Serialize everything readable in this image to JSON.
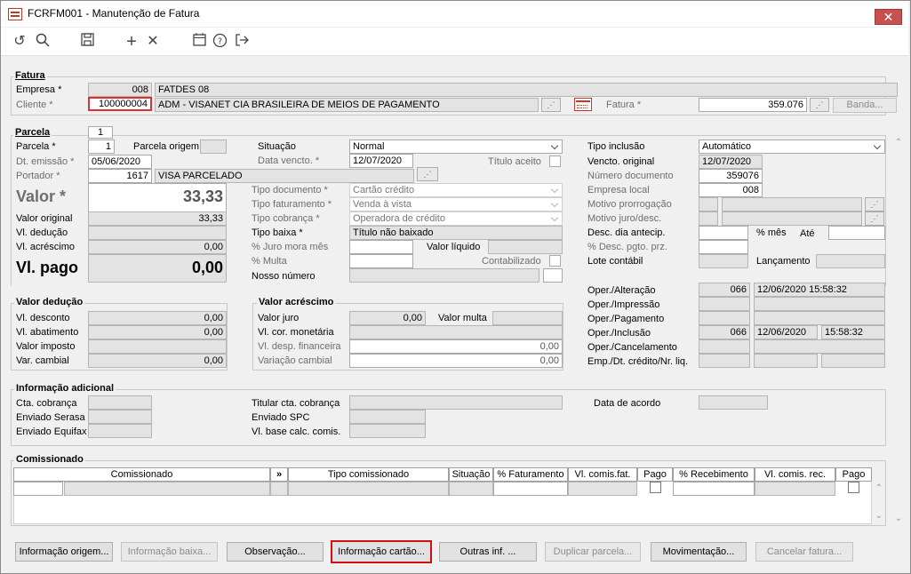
{
  "window": {
    "title": "FCRFM001 - Manutenção de Fatura",
    "close": "✕"
  },
  "toolbar": {
    "undo": "↺",
    "search": "🔍",
    "save": "💾",
    "add": "+",
    "delete": "✕",
    "calendar": "📅",
    "help": "?",
    "exit": "↦"
  },
  "fatura": {
    "section": "Fatura",
    "empresa_label": "Empresa *",
    "empresa_code": "008",
    "empresa_name": "FATDES 08",
    "cliente_label": "Cliente *",
    "cliente_code": "100000004",
    "cliente_name": "ADM - VISANET CIA BRASILEIRA DE MEIOS DE PAGAMENTO",
    "fatura_label": "Fatura *",
    "fatura_value": "359.076",
    "banda": "Banda..."
  },
  "parcela": {
    "section": "Parcela",
    "tab": "1",
    "parcela_label": "Parcela *",
    "parcela_value": "1",
    "parcela_origem": "Parcela origem",
    "dt_emissao_label": "Dt. emissão *",
    "dt_emissao": "05/06/2020",
    "portador_label": "Portador *",
    "portador_code": "1617",
    "portador_name": "VISA PARCELADO",
    "valor_label": "Valor *",
    "valor": "33,33",
    "valor_original_label": "Valor original",
    "valor_original": "33,33",
    "vl_deducao_label": "Vl. dedução",
    "vl_acrescimo_label": "Vl. acréscimo",
    "vl_acrescimo": "0,00",
    "vl_pago_label": "Vl. pago",
    "vl_pago": "0,00"
  },
  "mid": {
    "situacao_label": "Situação",
    "situacao": "Normal",
    "data_vencto_label": "Data vencto. *",
    "data_vencto": "12/07/2020",
    "titulo_aceito": "Título aceito",
    "tipo_documento_label": "Tipo documento *",
    "tipo_documento": "Cartão crédito",
    "tipo_faturamento_label": "Tipo faturamento *",
    "tipo_faturamento": "Venda à vista",
    "tipo_cobranca_label": "Tipo cobrança *",
    "tipo_cobranca": "Operadora de crédito",
    "tipo_baixa_label": "Tipo baixa *",
    "tipo_baixa": "Título não baixado",
    "juro_mora_label": "% Juro mora mês",
    "valor_liquido": "Valor líquido",
    "multa_label": "% Multa",
    "contabilizado": "Contabilizado",
    "nosso_numero_label": "Nosso número"
  },
  "right": {
    "tipo_inclusao_label": "Tipo inclusão",
    "tipo_inclusao": "Automático",
    "vencto_original_label": "Vencto. original",
    "vencto_original": "12/07/2020",
    "numero_documento_label": "Número documento",
    "numero_documento": "359076",
    "empresa_local_label": "Empresa local",
    "empresa_local": "008",
    "motivo_prorrogacao_label": "Motivo prorrogação",
    "motivo_juro_label": "Motivo juro/desc.",
    "desc_dia_antecip_label": "Desc. dia antecip.",
    "pct_mes": "% mês",
    "ate": "Até",
    "pct_desc_pgto_label": "% Desc. pgto. prz.",
    "lote_contabil_label": "Lote contábil",
    "lancamento": "Lançamento"
  },
  "oper": {
    "alteracao_label": "Oper./Alteração",
    "alteracao_code": "066",
    "alteracao_dt": "12/06/2020 15:58:32",
    "impressao_label": "Oper./Impressão",
    "pagamento_label": "Oper./Pagamento",
    "inclusao_label": "Oper./Inclusão",
    "inclusao_code": "066",
    "inclusao_date": "12/06/2020",
    "inclusao_time": "15:58:32",
    "cancelamento_label": "Oper./Cancelamento",
    "emp_dt_label": "Emp./Dt. crédito/Nr. liq."
  },
  "deducao": {
    "section": "Valor dedução",
    "desconto_label": "Vl. desconto",
    "desconto": "0,00",
    "abatimento_label": "Vl. abatimento",
    "abatimento": "0,00",
    "imposto_label": "Valor imposto",
    "cambial_label": "Var. cambial",
    "cambial": "0,00"
  },
  "acrescimo": {
    "section": "Valor acréscimo",
    "juro_label": "Valor juro",
    "juro": "0,00",
    "multa_label": "Valor multa",
    "cor_label": "Vl. cor. monetária",
    "desp_label": "Vl. desp. financeira",
    "desp": "0,00",
    "var_label": "Variação cambial",
    "var": "0,00"
  },
  "adicional": {
    "section": "Informação adicional",
    "cta_label": "Cta. cobrança",
    "serasa_label": "Enviado Serasa",
    "equifax_label": "Enviado Equifax",
    "titular_label": "Titular cta. cobrança",
    "spc_label": "Enviado SPC",
    "base_label": "Vl. base calc. comis.",
    "acordo_label": "Data de acordo"
  },
  "comissionado": {
    "section": "Comissionado",
    "columns": [
      "Comissionado",
      "»",
      "Tipo comissionado",
      "Situação",
      "% Faturamento",
      "Vl. comis.fat.",
      "Pago",
      "% Recebimento",
      "Vl. comis. rec.",
      "Pago"
    ]
  },
  "buttons": {
    "info_origem": "Informação origem...",
    "info_baixa": "Informação baixa...",
    "observacao": "Observação...",
    "info_cartao": "Informação cartão...",
    "outras": "Outras inf. ...",
    "duplicar": "Duplicar parcela...",
    "movimentacao": "Movimentação...",
    "cancelar": "Cancelar fatura..."
  }
}
